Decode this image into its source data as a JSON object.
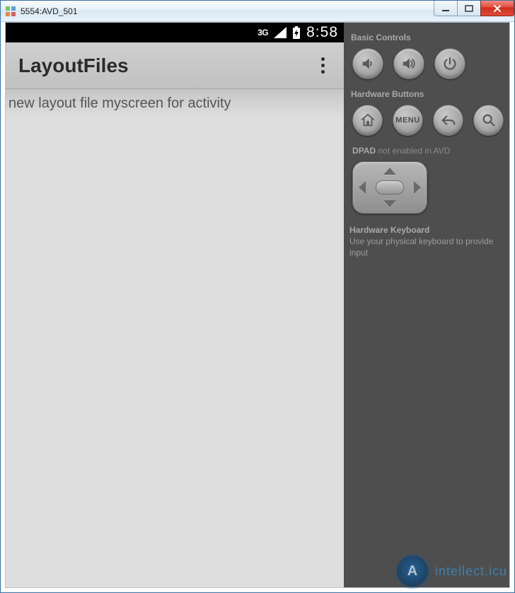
{
  "window": {
    "title": "5554:AVD_501"
  },
  "statusbar": {
    "network": "3G",
    "time": "8:58"
  },
  "appbar": {
    "title": "LayoutFiles"
  },
  "content": {
    "line1": "new layout file myscreen for activity"
  },
  "side": {
    "basic_controls_label": "Basic Controls",
    "hardware_buttons_label": "Hardware Buttons",
    "menu_btn_label": "MENU",
    "dpad_label": "DPAD",
    "dpad_sub": "not enabled in AVD",
    "keyboard_title": "Hardware Keyboard",
    "keyboard_sub": "Use your physical keyboard to provide input"
  },
  "watermark": {
    "badge_letter": "A",
    "text": "intellect.icu"
  }
}
